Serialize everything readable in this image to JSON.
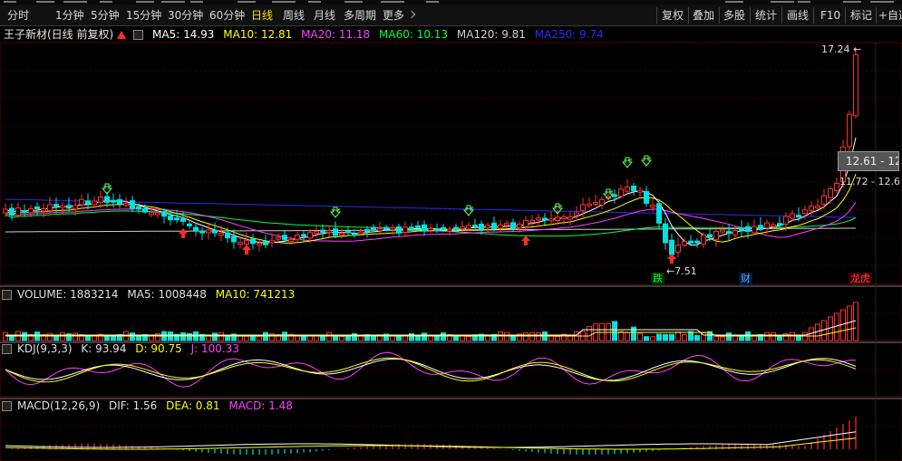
{
  "toolbar": {
    "periods": [
      {
        "label": "分时",
        "active": false
      },
      {
        "label": "1分钟",
        "active": false
      },
      {
        "label": "5分钟",
        "active": false
      },
      {
        "label": "15分钟",
        "active": false
      },
      {
        "label": "30分钟",
        "active": false
      },
      {
        "label": "60分钟",
        "active": false
      },
      {
        "label": "日线",
        "active": true
      },
      {
        "label": "周线",
        "active": false
      },
      {
        "label": "月线",
        "active": false
      },
      {
        "label": "多周期",
        "active": false
      },
      {
        "label": "更多",
        "active": false
      }
    ],
    "right_buttons": [
      "复权",
      "叠加",
      "多股",
      "统计",
      "画线",
      "F10",
      "标记",
      "+自选"
    ]
  },
  "main": {
    "stock_title": "王子新材(日线 前复权)",
    "ma": [
      {
        "label": "MA5: 14.93",
        "color": "#ffffff"
      },
      {
        "label": "MA10: 12.81",
        "color": "#ffff00"
      },
      {
        "label": "MA20: 11.18",
        "color": "#ff40ff"
      },
      {
        "label": "MA60: 10.13",
        "color": "#00ff40"
      },
      {
        "label": "MA120: 9.81",
        "color": "#cfcfcf"
      },
      {
        "label": "MA250: 9.74",
        "color": "#2a2aff"
      }
    ],
    "high_label": "17.24",
    "low_label": "7.51",
    "price_box": "12.61 - 12",
    "price_range": "11.72 - 12.6",
    "events": [
      {
        "label": "跌",
        "color": "#00ff40"
      },
      {
        "label": "财",
        "color": "#5aa0ff"
      },
      {
        "label": "龙虎",
        "color": "#ff4040"
      }
    ]
  },
  "volume": {
    "title": "VOLUME: 1883214",
    "ma5": "MA5: 1008448",
    "ma10": "MA10: 741213"
  },
  "kdj": {
    "title": "KDJ(9,3,3)",
    "k": "K: 93.94",
    "d": "D: 90.75",
    "j": "J: 100.33"
  },
  "macd": {
    "title": "MACD(12,26,9)",
    "dif": "DIF: 1.56",
    "dea": "DEA: 0.81",
    "macd": "MACD: 1.48"
  },
  "colors": {
    "up": "#ff3030",
    "down": "#00e0e0",
    "ma5": "#ffffff",
    "ma10": "#ffff00",
    "ma20": "#ff40ff",
    "ma60": "#00ff40",
    "ma120": "#cfcfcf",
    "ma250": "#2a2aff",
    "kdj_k": "#ffffff",
    "kdj_d": "#ffff00",
    "kdj_j": "#ff40ff"
  }
}
